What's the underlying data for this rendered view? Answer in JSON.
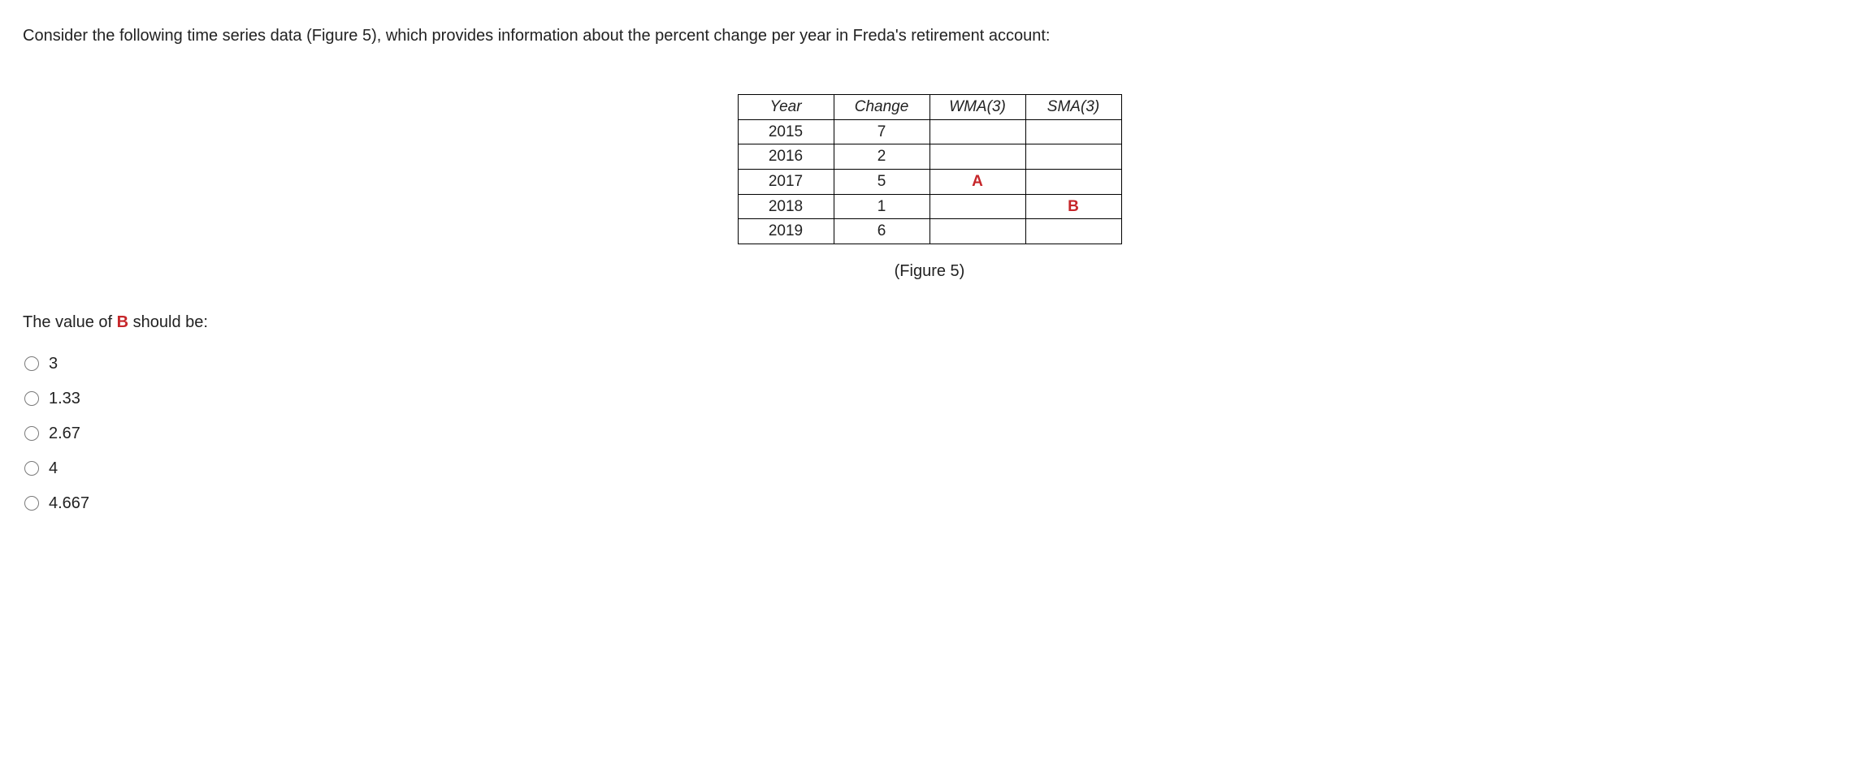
{
  "question": {
    "intro": "Consider the following time series data (Figure 5), which provides information about the percent change per year in Freda's retirement account:",
    "caption": "(Figure 5)",
    "prompt_prefix": "The value of ",
    "prompt_bold": "B",
    "prompt_suffix": " should be:"
  },
  "table": {
    "headers": [
      "Year",
      "Change",
      "WMA(3)",
      "SMA(3)"
    ],
    "rows": [
      {
        "year": "2015",
        "change": "7",
        "wma": "",
        "sma": ""
      },
      {
        "year": "2016",
        "change": "2",
        "wma": "",
        "sma": ""
      },
      {
        "year": "2017",
        "change": "5",
        "wma": "A",
        "sma": ""
      },
      {
        "year": "2018",
        "change": "1",
        "wma": "",
        "sma": "B"
      },
      {
        "year": "2019",
        "change": "6",
        "wma": "",
        "sma": ""
      }
    ]
  },
  "chart_data": {
    "type": "table",
    "title": "Percent change per year in Freda's retirement account",
    "columns": [
      "Year",
      "Change",
      "WMA(3)",
      "SMA(3)"
    ],
    "data": [
      {
        "Year": 2015,
        "Change": 7,
        "WMA(3)": null,
        "SMA(3)": null
      },
      {
        "Year": 2016,
        "Change": 2,
        "WMA(3)": null,
        "SMA(3)": null
      },
      {
        "Year": 2017,
        "Change": 5,
        "WMA(3)": "A",
        "SMA(3)": null
      },
      {
        "Year": 2018,
        "Change": 1,
        "WMA(3)": null,
        "SMA(3)": "B"
      },
      {
        "Year": 2019,
        "Change": 6,
        "WMA(3)": null,
        "SMA(3)": null
      }
    ]
  },
  "options": [
    {
      "label": "3"
    },
    {
      "label": "1.33"
    },
    {
      "label": "2.67"
    },
    {
      "label": "4"
    },
    {
      "label": "4.667"
    }
  ]
}
